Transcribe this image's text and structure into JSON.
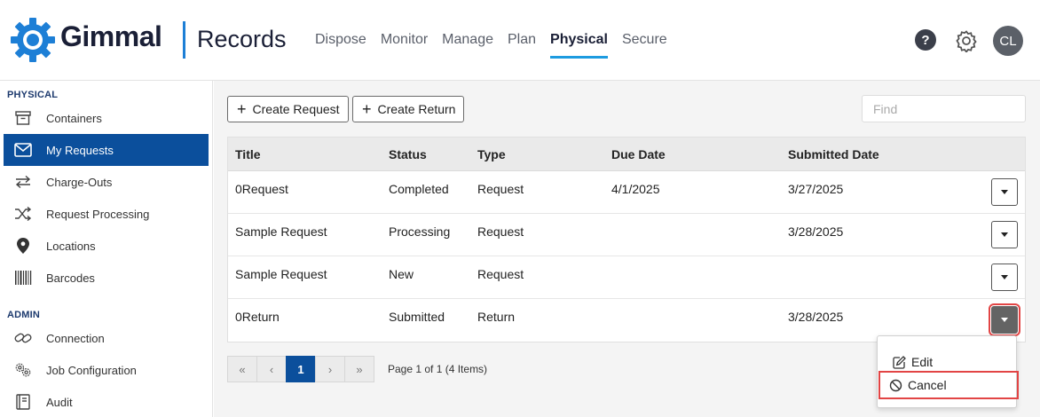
{
  "brand": {
    "logo_text": "Gimmal",
    "app_name": "Records"
  },
  "topnav": [
    "Dispose",
    "Monitor",
    "Manage",
    "Plan",
    "Physical",
    "Secure"
  ],
  "topnav_active": "Physical",
  "header": {
    "help_label": "?",
    "avatar_initials": "CL"
  },
  "sidebar": {
    "physical_label": "PHYSICAL",
    "physical_items": [
      "Containers",
      "My Requests",
      "Charge-Outs",
      "Request Processing",
      "Locations",
      "Barcodes"
    ],
    "admin_label": "ADMIN",
    "admin_items": [
      "Connection",
      "Job Configuration",
      "Audit"
    ],
    "active": "My Requests"
  },
  "toolbar": {
    "create_request": "Create Request",
    "create_return": "Create Return",
    "find_placeholder": "Find"
  },
  "table": {
    "columns": [
      "Title",
      "Status",
      "Type",
      "Due Date",
      "Submitted Date"
    ],
    "rows": [
      [
        "0Request",
        "Completed",
        "Request",
        "4/1/2025",
        "3/27/2025"
      ],
      [
        "Sample Request",
        "Processing",
        "Request",
        "",
        "3/28/2025"
      ],
      [
        "Sample Request",
        "New",
        "Request",
        "",
        ""
      ],
      [
        "0Return",
        "Submitted",
        "Return",
        "",
        "3/28/2025"
      ]
    ]
  },
  "pager": {
    "current_page": "1",
    "info": "Page 1 of 1 (4 Items)"
  },
  "row_menu": {
    "edit": "Edit",
    "cancel": "Cancel"
  },
  "colors": {
    "brand_blue": "#1d7fd6",
    "active_nav": "#0b4f9c",
    "highlight_red": "#e24545"
  }
}
